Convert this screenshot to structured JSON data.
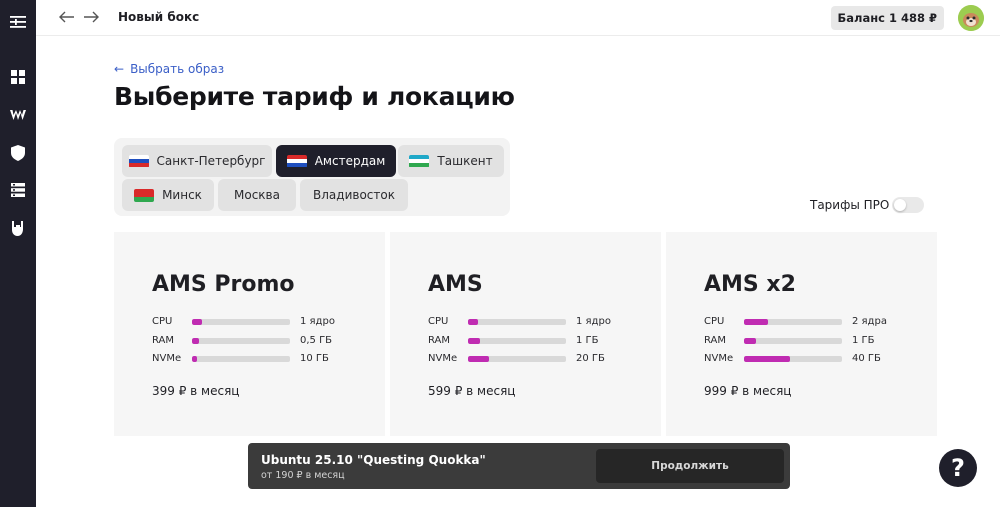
{
  "header": {
    "page_name": "Новый бокс",
    "balance": "Баланс 1 488 ₽"
  },
  "main": {
    "back_link": "Выбрать образ",
    "title": "Выберите тариф и локацию",
    "locations": [
      {
        "label": "Санкт-Петербург",
        "flag": "ru",
        "selected": false
      },
      {
        "label": "Амстердам",
        "flag": "nl",
        "selected": true
      },
      {
        "label": "Ташкент",
        "flag": "uz",
        "selected": false
      },
      {
        "label": "Минск",
        "flag": "by",
        "selected": false
      },
      {
        "label": "Москва",
        "flag": "",
        "selected": false
      },
      {
        "label": "Владивосток",
        "flag": "",
        "selected": false
      }
    ],
    "pro_toggle": {
      "label": "Тарифы ПРО",
      "on": false
    },
    "plans": [
      {
        "name": "AMS Promo",
        "specs": [
          {
            "name": "CPU",
            "value": "1 ядро",
            "level": 0.1
          },
          {
            "name": "RAM",
            "value": "0,5 ГБ",
            "level": 0.07
          },
          {
            "name": "NVMe",
            "value": "10 ГБ",
            "level": 0.05
          }
        ],
        "price": "399 ₽ в месяц"
      },
      {
        "name": "AMS",
        "specs": [
          {
            "name": "CPU",
            "value": "1 ядро",
            "level": 0.1
          },
          {
            "name": "RAM",
            "value": "1 ГБ",
            "level": 0.12
          },
          {
            "name": "NVMe",
            "value": "20 ГБ",
            "level": 0.21
          }
        ],
        "price": "599 ₽ в месяц"
      },
      {
        "name": "AMS x2",
        "specs": [
          {
            "name": "CPU",
            "value": "2 ядра",
            "level": 0.24
          },
          {
            "name": "RAM",
            "value": "1 ГБ",
            "level": 0.12
          },
          {
            "name": "NVMe",
            "value": "40 ГБ",
            "level": 0.47
          }
        ],
        "price": "999 ₽ в месяц"
      }
    ]
  },
  "bottom_bar": {
    "os_name": "Ubuntu 25.10 \"Questing Quokka\"",
    "os_price": "от 190 ₽ в месяц",
    "continue_label": "Продолжить"
  },
  "help_label": "?",
  "colors": {
    "sidebar": "#1f1f2b",
    "accent_bar": "#c02cb2",
    "link": "#3b5fc7",
    "selected_location": "#1f1f2b"
  },
  "icons": {
    "sidebar": [
      "menu-icon",
      "dashboard-icon",
      "wordpress-icon",
      "shield-icon",
      "servers-icon",
      "rock-hand-icon"
    ],
    "topbar": [
      "back-arrow-icon",
      "forward-arrow-icon"
    ]
  }
}
